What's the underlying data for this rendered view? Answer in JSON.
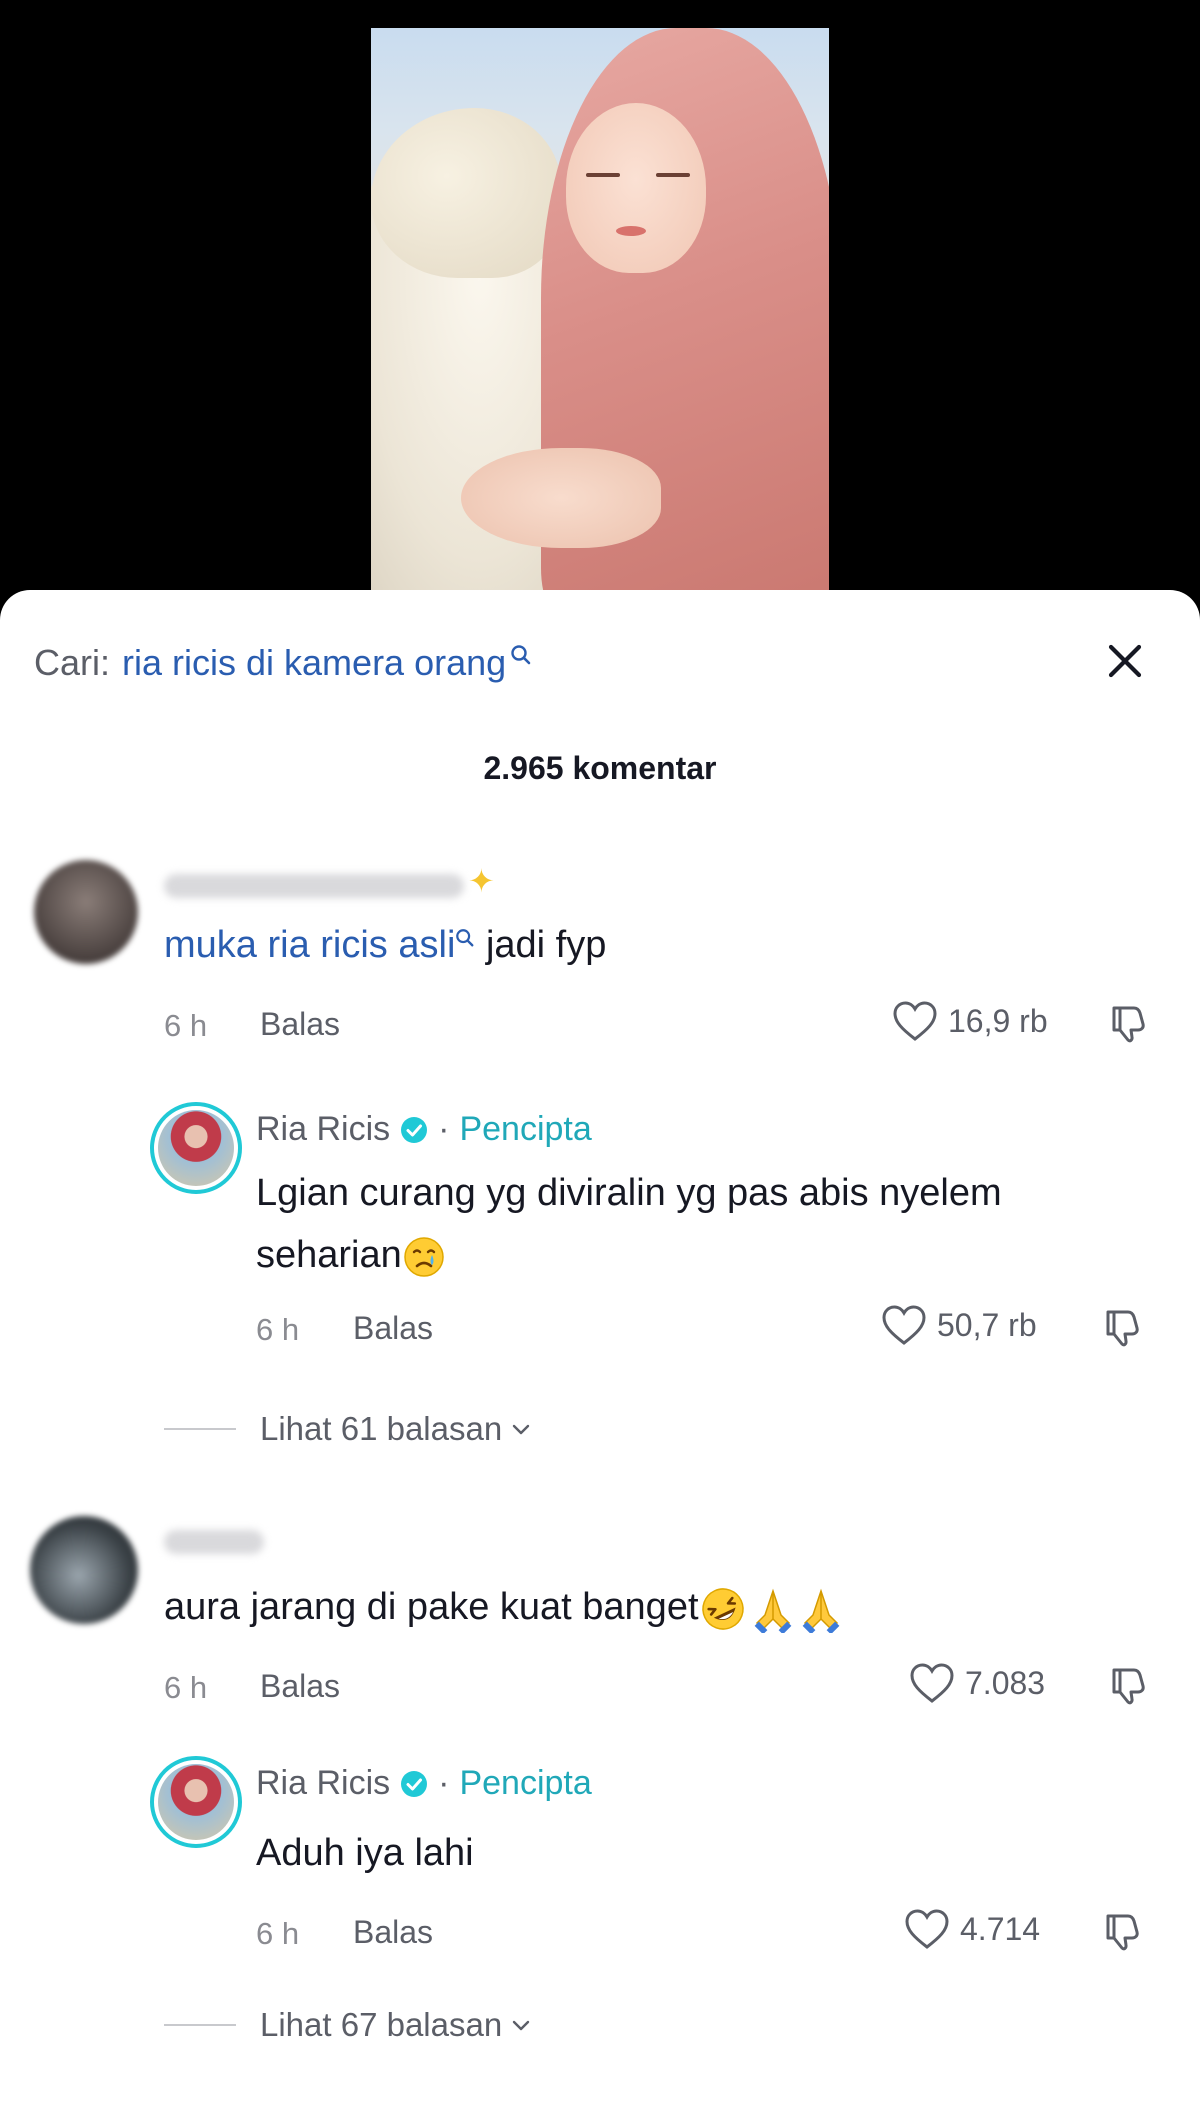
{
  "search": {
    "prefix": "Cari:",
    "query": "ria ricis di kamera orang"
  },
  "comments_header": {
    "count_label": "2.965 komentar"
  },
  "comments": [
    {
      "mention": "muka ria ricis asli",
      "text": " jadi fyp",
      "time": "6 h",
      "reply_label": "Balas",
      "likes": "16,9 rb",
      "reply": {
        "username": "Ria Ricis",
        "badge": "Pencipta",
        "text": "Lgian curang yg diviralin yg pas abis nyelem seharian",
        "emoji": "crying-face-emoji",
        "time": "6 h",
        "reply_label": "Balas",
        "likes": "50,7 rb"
      },
      "view_replies": "Lihat 61 balasan"
    },
    {
      "text": "aura jarang di pake kuat banget",
      "emojis": [
        "rofl-emoji",
        "folded-hands-emoji",
        "folded-hands-emoji"
      ],
      "time": "6 h",
      "reply_label": "Balas",
      "likes": "7.083",
      "reply": {
        "username": "Ria Ricis",
        "badge": "Pencipta",
        "text": "Aduh iya lahi",
        "time": "6 h",
        "reply_label": "Balas",
        "likes": "4.714"
      },
      "view_replies": "Lihat 67 balasan"
    }
  ],
  "colors": {
    "link": "#2a5db0",
    "creator_badge": "#20a8b8",
    "secondary_text": "#5b5e67"
  }
}
